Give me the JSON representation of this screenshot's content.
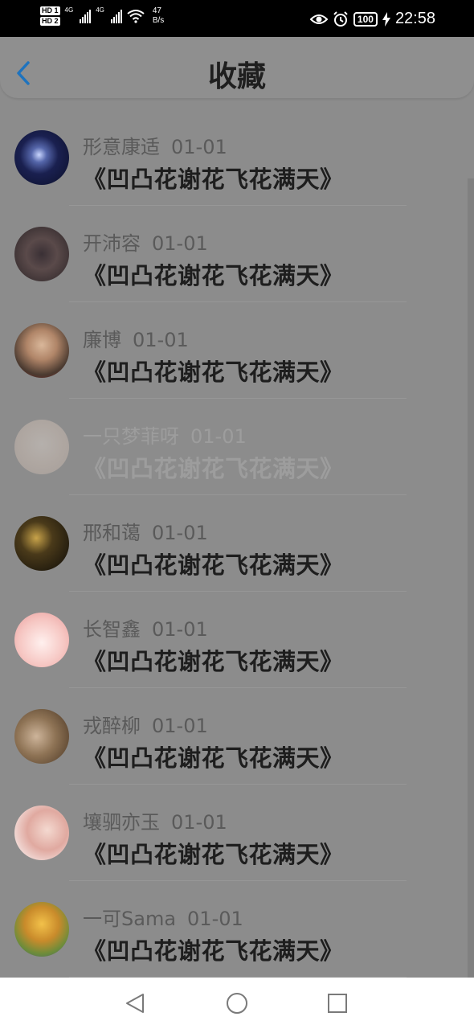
{
  "status_bar": {
    "hd1": "HD 1",
    "hd2": "HD 2",
    "sig1_label": "4G",
    "sig2_label": "4G",
    "netspeed_value": "47",
    "netspeed_unit": "B/s",
    "battery": "100",
    "time": "22:58",
    "icons": [
      "signal-icon",
      "wifi-icon",
      "eye-icon",
      "alarm-icon",
      "battery-icon",
      "charging-icon"
    ]
  },
  "header": {
    "title": "收藏",
    "back_icon": "chevron-left-icon",
    "accent": "#1e73be"
  },
  "favorites": [
    {
      "user": "形意康适",
      "date": "01-01",
      "book": "《凹凸花谢花飞花满天》",
      "faded": false
    },
    {
      "user": "开沛容",
      "date": "01-01",
      "book": "《凹凸花谢花飞花满天》",
      "faded": false
    },
    {
      "user": "廉博",
      "date": "01-01",
      "book": "《凹凸花谢花飞花满天》",
      "faded": false
    },
    {
      "user": "一只梦菲呀",
      "date": "01-01",
      "book": "《凹凸花谢花飞花满天》",
      "faded": true
    },
    {
      "user": "邢和蔼",
      "date": "01-01",
      "book": "《凹凸花谢花飞花满天》",
      "faded": false
    },
    {
      "user": "长智鑫",
      "date": "01-01",
      "book": "《凹凸花谢花飞花满天》",
      "faded": false
    },
    {
      "user": "戎醉柳",
      "date": "01-01",
      "book": "《凹凸花谢花飞花满天》",
      "faded": false
    },
    {
      "user": "壤驷亦玉",
      "date": "01-01",
      "book": "《凹凸花谢花飞花满天》",
      "faded": false
    },
    {
      "user": "一可Sama",
      "date": "01-01",
      "book": "《凹凸花谢花飞花满天》",
      "faded": false
    }
  ],
  "navbar": {
    "back_icon": "triangle-back-icon",
    "home_icon": "circle-home-icon",
    "recents_icon": "square-recents-icon"
  }
}
